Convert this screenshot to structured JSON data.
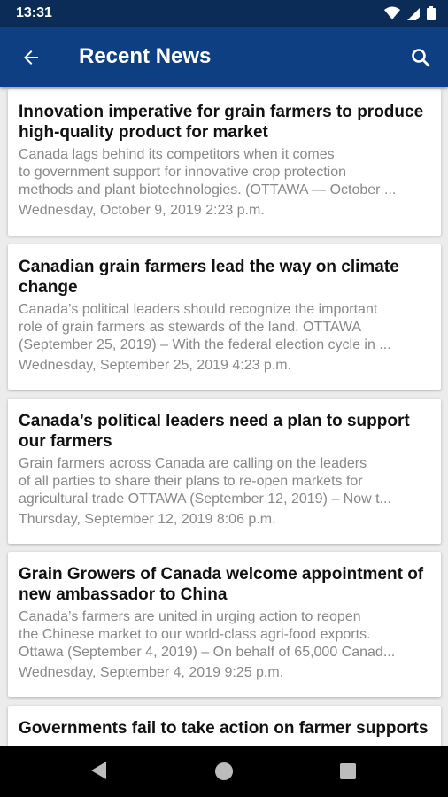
{
  "status_bar": {
    "time": "13:31"
  },
  "app_bar": {
    "title": "Recent News"
  },
  "news": [
    {
      "title": "Innovation imperative for grain farmers to produce high-quality product for market",
      "summary": [
        "Canada lags behind its competitors when it comes",
        "to government support for innovative crop protection",
        "methods and plant biotechnologies. (OTTAWA — October ..."
      ],
      "date": "Wednesday, October 9, 2019 2:23 p.m."
    },
    {
      "title": "Canadian grain farmers lead the way on climate change",
      "summary": [
        "Canada’s political leaders should recognize the important",
        "role of grain farmers as stewards of the land. OTTAWA",
        "(September 25, 2019) – With the federal election cycle in ..."
      ],
      "date": "Wednesday, September 25, 2019 4:23 p.m."
    },
    {
      "title": "Canada’s political leaders need a plan to support our farmers",
      "summary": [
        "Grain farmers across Canada are calling on the leaders",
        "of all parties to share their plans to re-open markets for",
        "agricultural trade OTTAWA (September 12, 2019) – Now t..."
      ],
      "date": "Thursday, September 12, 2019 8:06 p.m."
    },
    {
      "title": "Grain Growers of Canada welcome appointment of new ambassador to China",
      "summary": [
        "Canada’s farmers are united in urging action to reopen",
        "the Chinese market to our world-class agri-food exports.",
        "Ottawa (September 4, 2019) – On behalf of 65,000 Canad..."
      ],
      "date": "Wednesday, September 4, 2019 9:25 p.m."
    },
    {
      "title": "Governments fail to take action on farmer supports"
    }
  ]
}
